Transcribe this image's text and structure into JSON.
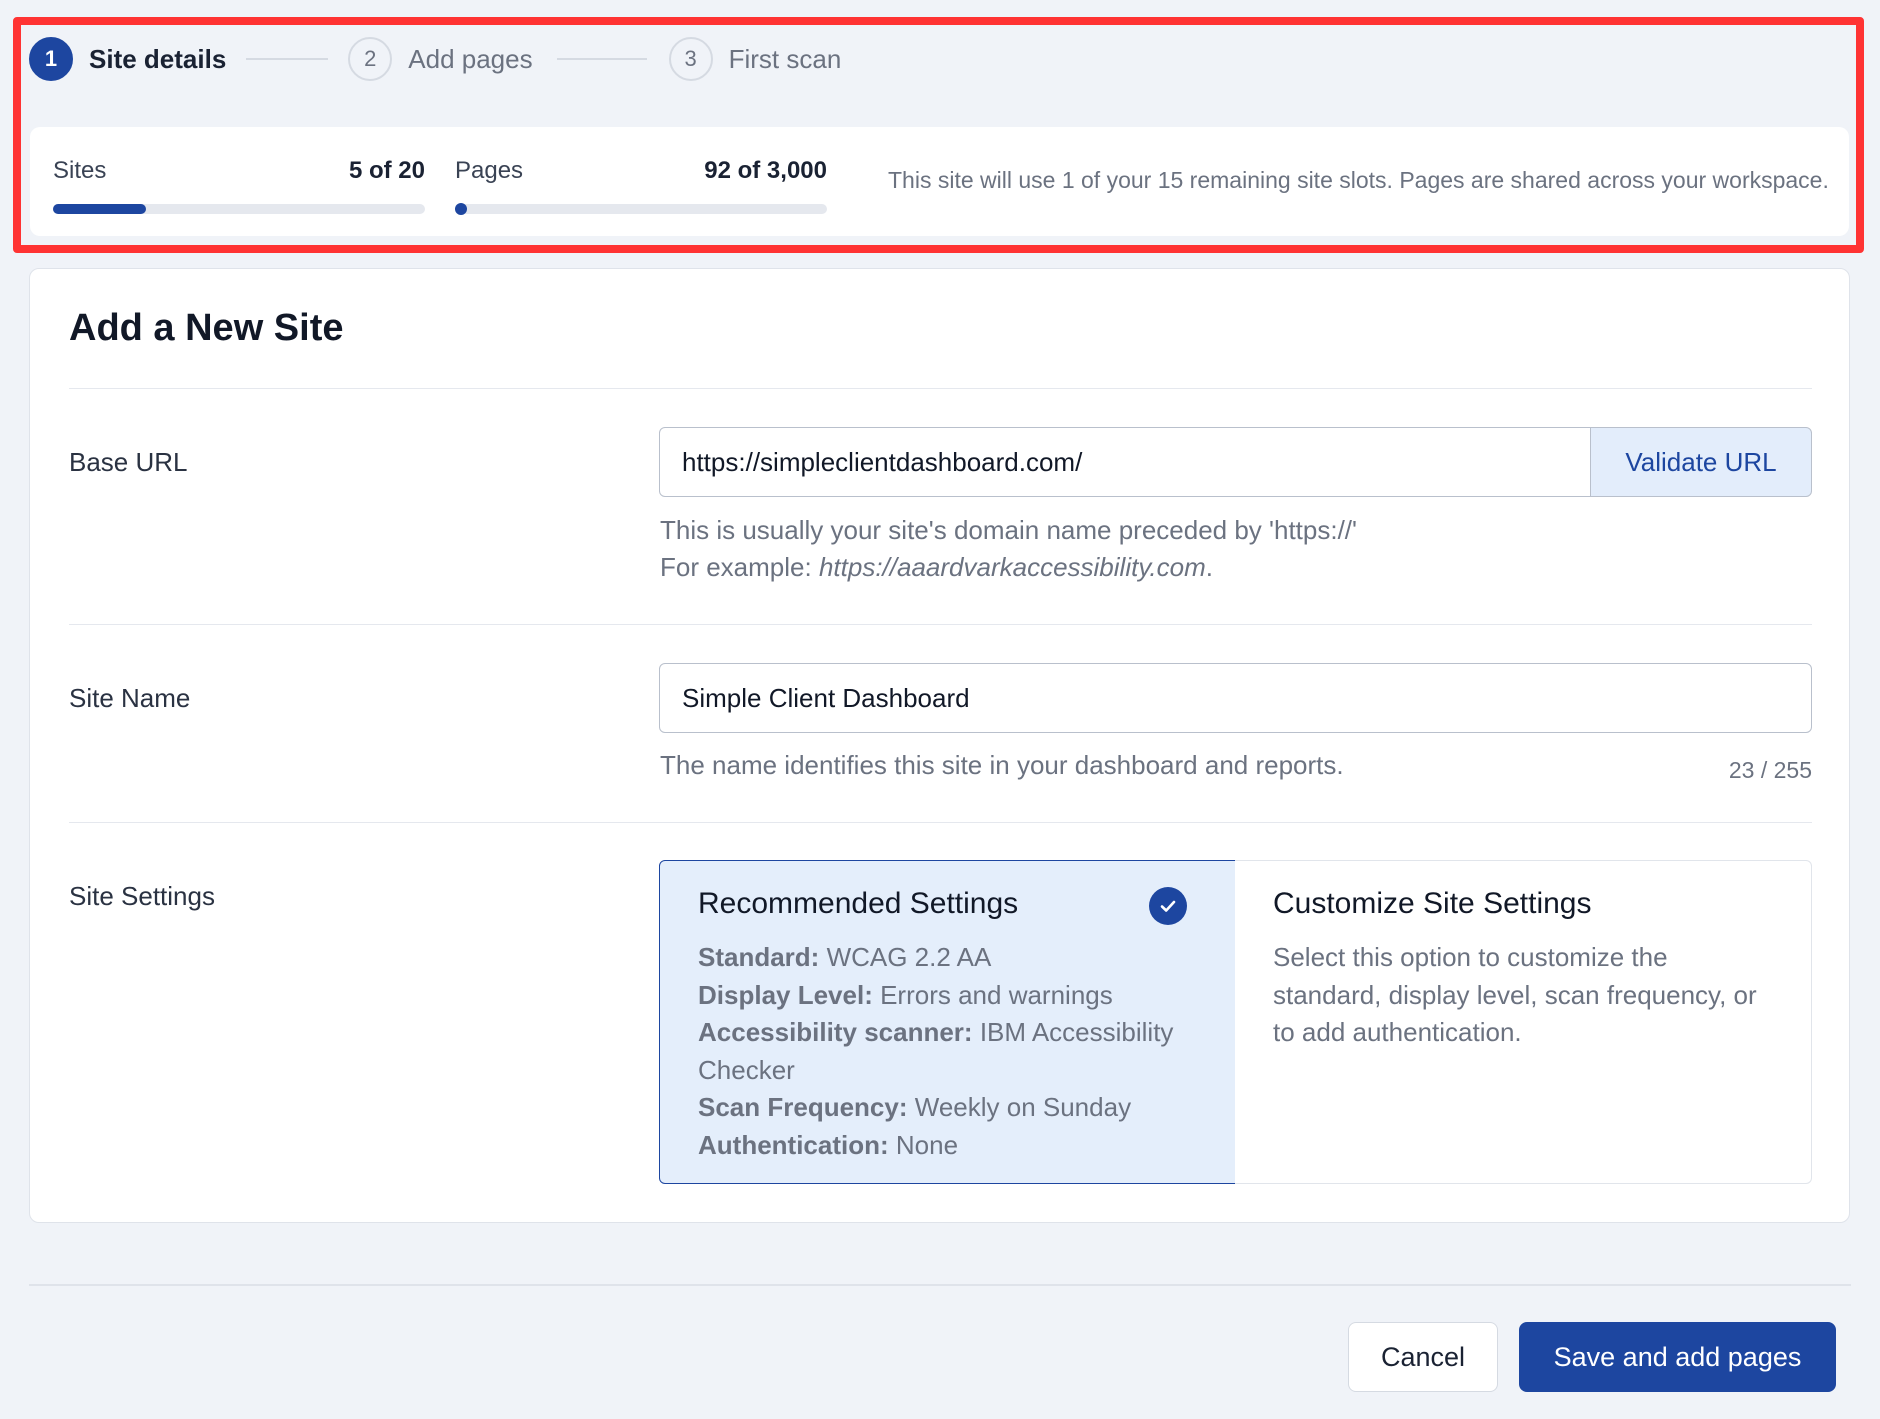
{
  "stepper": {
    "steps": [
      {
        "number": "1",
        "label": "Site details"
      },
      {
        "number": "2",
        "label": "Add pages"
      },
      {
        "number": "3",
        "label": "First scan"
      }
    ]
  },
  "usage": {
    "sites": {
      "label": "Sites",
      "value": "5 of 20",
      "fraction": 0.25
    },
    "pages": {
      "label": "Pages",
      "value": "92 of 3,000",
      "fraction": 0.0307
    },
    "note": "This site will use 1 of your 15 remaining site slots. Pages are shared across your workspace."
  },
  "form": {
    "title": "Add a New Site",
    "base_url": {
      "label": "Base URL",
      "value": "https://simpleclientdashboard.com/",
      "validate_label": "Validate URL",
      "help_line1": "This is usually your site's domain name preceded by 'https://'",
      "help_line2_prefix": "For example: ",
      "help_example": "https://aaardvarkaccessibility.com",
      "help_line2_suffix": "."
    },
    "site_name": {
      "label": "Site Name",
      "value": "Simple Client Dashboard",
      "help": "The name identifies this site in your dashboard and reports.",
      "counter": "23 / 255"
    },
    "site_settings": {
      "label": "Site Settings",
      "recommended": {
        "title": "Recommended Settings",
        "selected_icon": "check-circle-icon",
        "items": [
          {
            "key": "Standard:",
            "value": "WCAG 2.2 AA"
          },
          {
            "key": "Display Level:",
            "value": "Errors and warnings"
          },
          {
            "key": "Accessibility scanner:",
            "value": "IBM Accessibility Checker"
          },
          {
            "key": "Scan Frequency:",
            "value": "Weekly on Sunday"
          },
          {
            "key": "Authentication:",
            "value": "None"
          }
        ]
      },
      "custom": {
        "title": "Customize Site Settings",
        "description": "Select this option to customize the standard, display level, scan frequency, or to add authentication."
      }
    }
  },
  "footer": {
    "cancel_label": "Cancel",
    "save_label": "Save and add pages"
  },
  "colors": {
    "accent": "#1d46a0",
    "highlight": "#ff3333",
    "selected_bg": "#e4eefb"
  }
}
